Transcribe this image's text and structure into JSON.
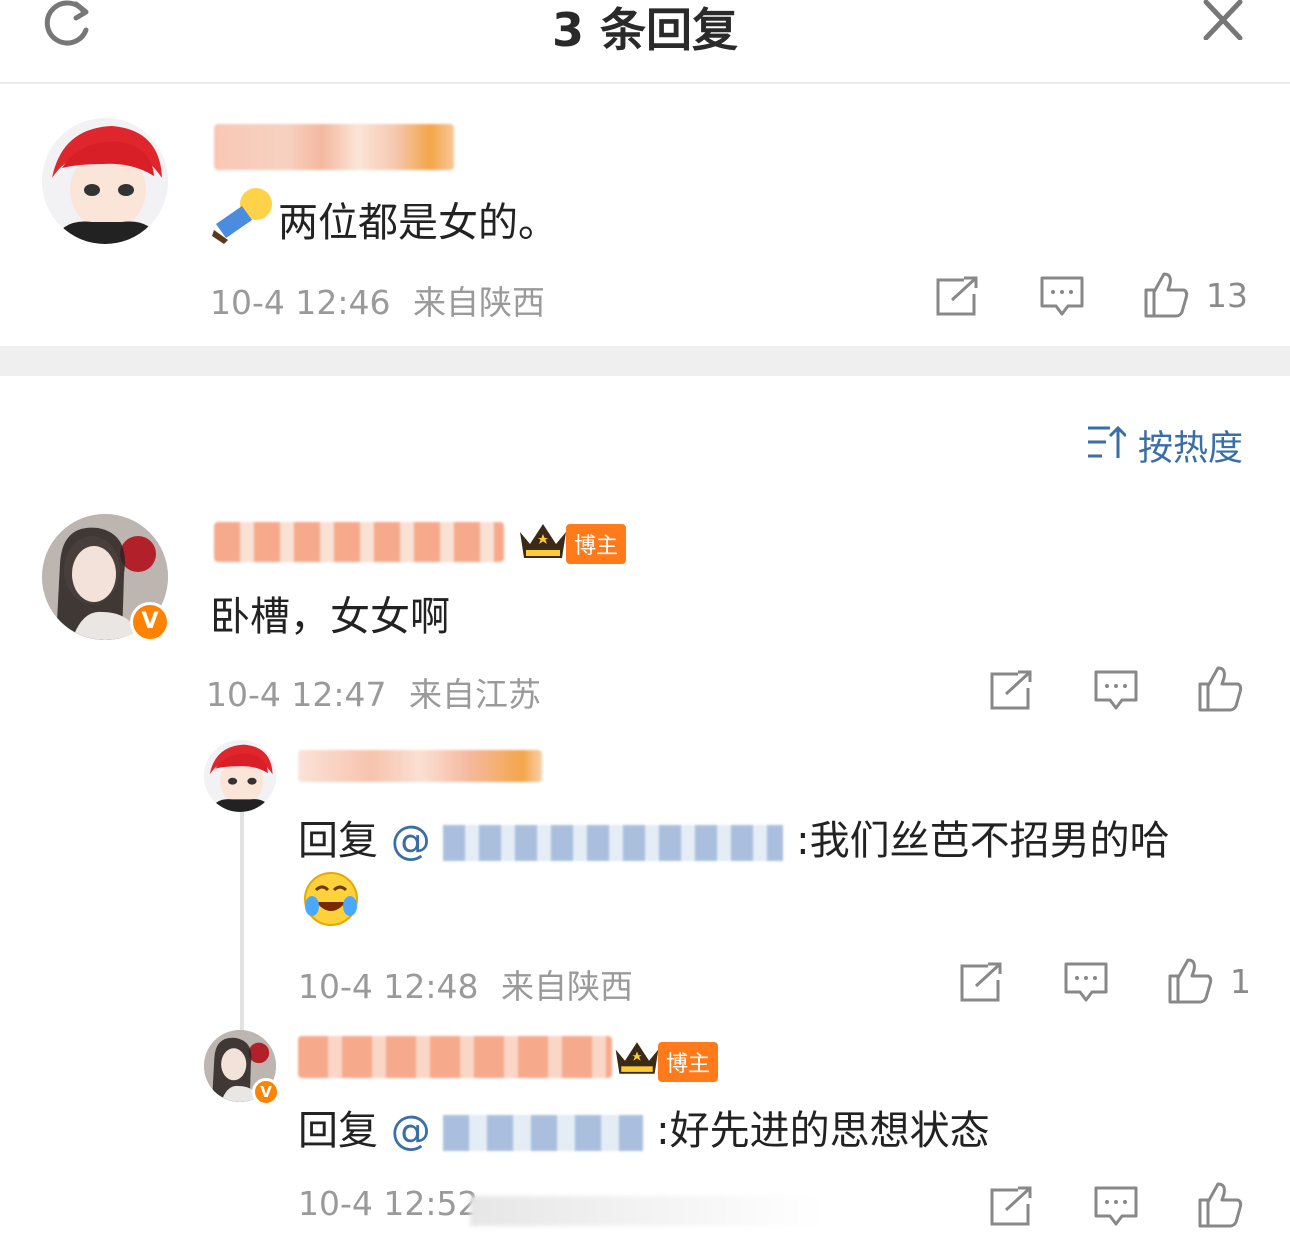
{
  "header": {
    "title": "3 条回复",
    "refresh_icon": "refresh-icon",
    "close_icon": "close-icon"
  },
  "main_comment": {
    "text": "两位都是女的。",
    "time": "10-4 12:46",
    "location": "来自陕西",
    "likes": "13"
  },
  "sort": {
    "label": "按热度",
    "icon": "sort-icon"
  },
  "replies": [
    {
      "badge": "博主",
      "text": "卧槽，女女啊",
      "time": "10-4 12:47",
      "location": "来自江苏",
      "likes": "",
      "verified": "V"
    },
    {
      "prefix": "回复",
      "at": "@",
      "text_after": ":我们丝芭不招男的哈",
      "time": "10-4 12:48",
      "location": "来自陕西",
      "likes": "1"
    },
    {
      "badge": "博主",
      "prefix": "回复",
      "at": "@",
      "text_after": ":好先进的思想状态",
      "time": "10-4 12:52",
      "likes": "",
      "verified": "V"
    }
  ],
  "colors": {
    "accent_blue": "#3a6ea6",
    "badge_orange": "#ff7a1a",
    "verified_orange": "#ff8200",
    "meta_gray": "#9a9a9a"
  }
}
